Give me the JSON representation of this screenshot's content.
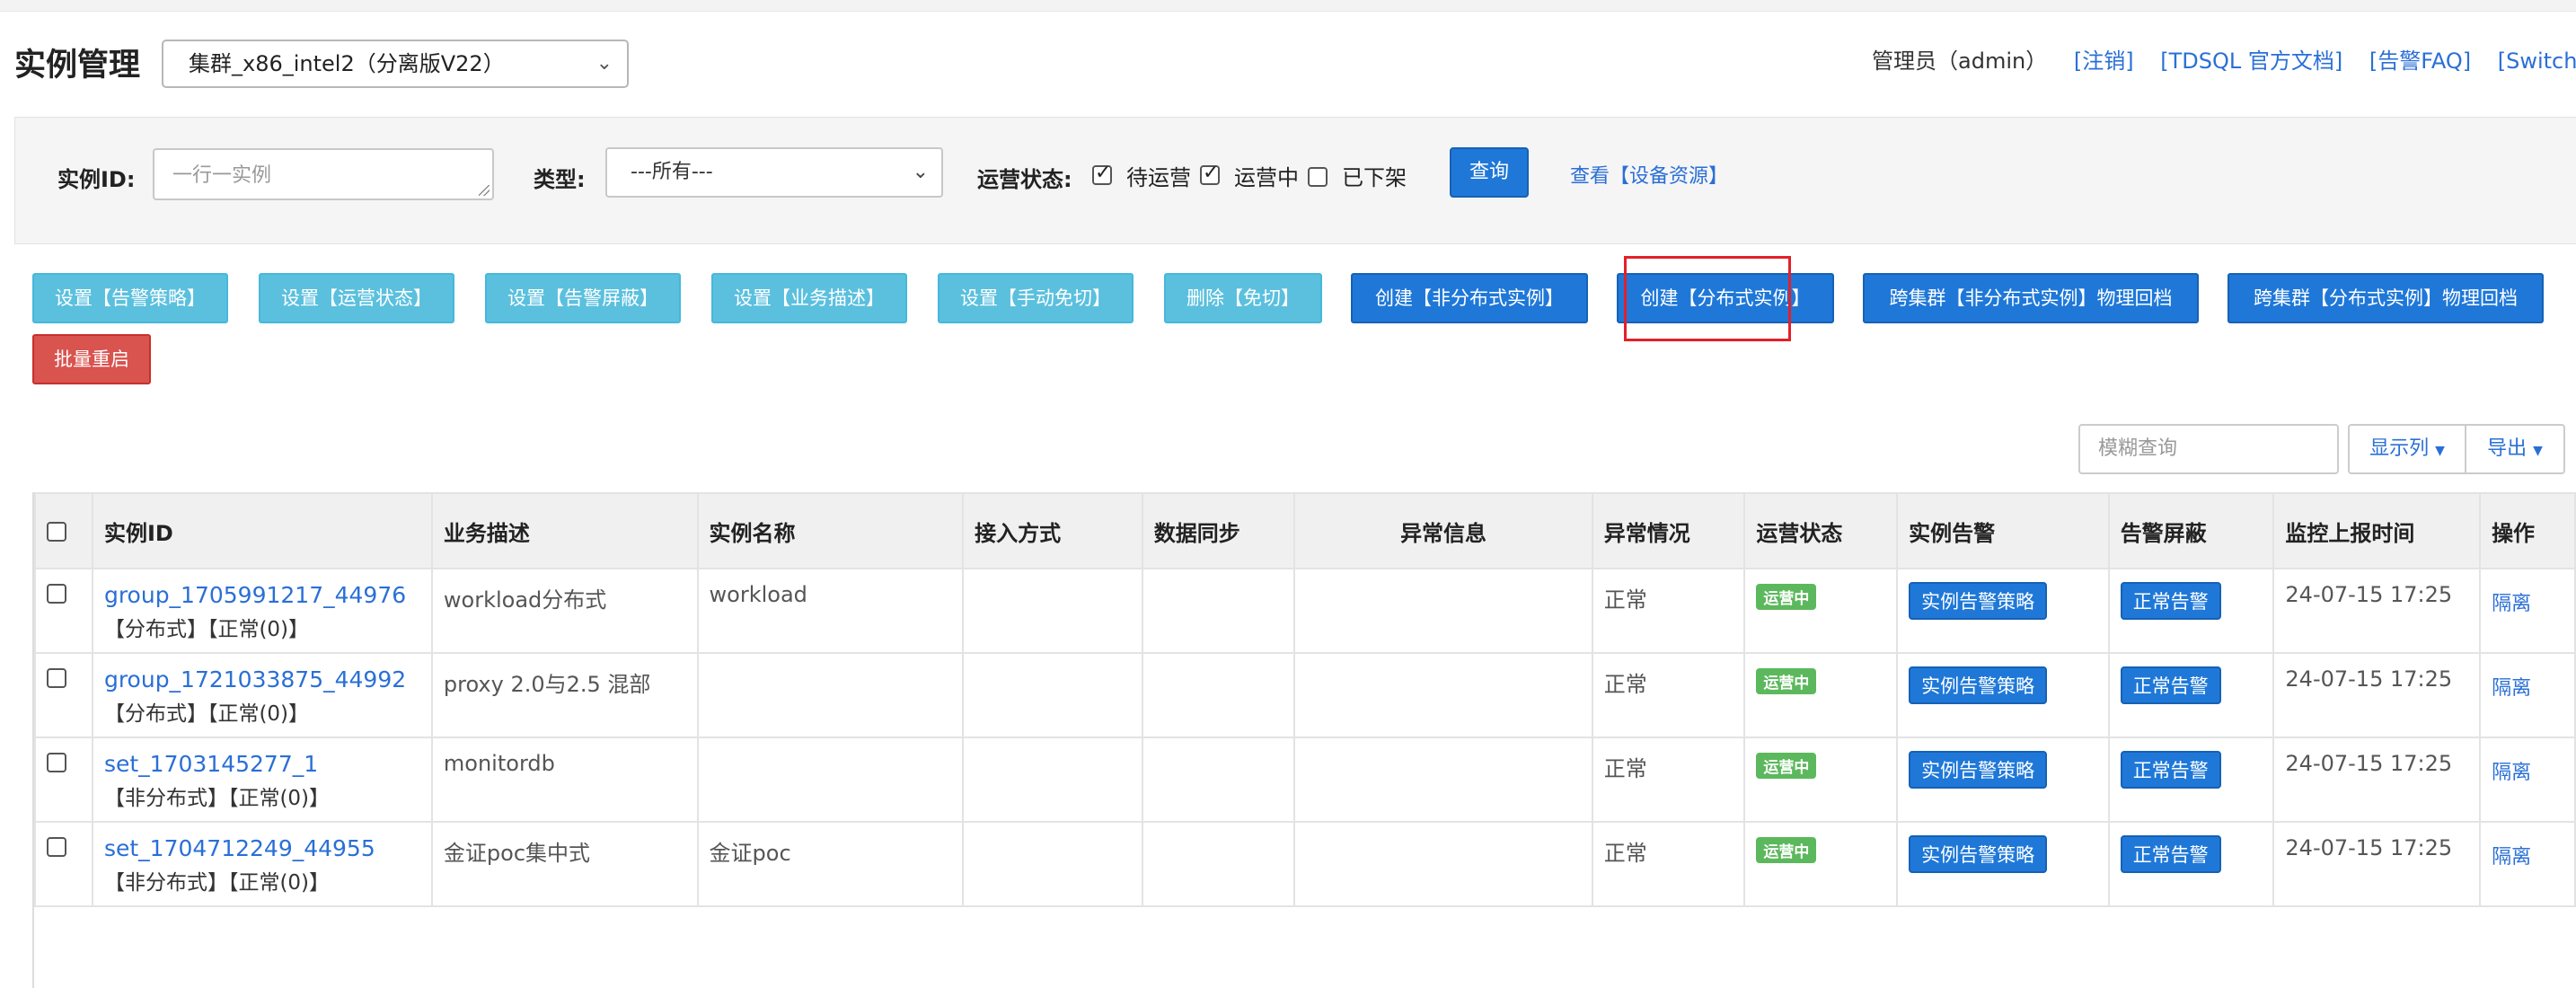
{
  "header": {
    "title": "实例管理",
    "cluster_select": "集群_x86_intel2（分离版V22）",
    "admin": "管理员（admin）",
    "links": [
      "[注销]",
      "[TDSQL 官方文档]",
      "[告警FAQ]",
      "[Switch English]"
    ]
  },
  "filter": {
    "id_label": "实例ID:",
    "id_placeholder": "一行一实例",
    "type_label": "类型:",
    "type_value": "---所有---",
    "status_label": "运营状态:",
    "status_options": [
      {
        "label": "待运营",
        "checked": true
      },
      {
        "label": "运营中",
        "checked": true
      },
      {
        "label": "已下架",
        "checked": false
      }
    ],
    "query_button": "查询",
    "view_link": "查看【设备资源】"
  },
  "actions": [
    "设置【告警策略】",
    "设置【运营状态】",
    "设置【告警屏蔽】",
    "设置【业务描述】",
    "设置【手动免切】",
    "删除【免切】",
    "创建【非分布式实例】",
    "创建【分布式实例】",
    "跨集群【非分布式实例】物理回档",
    "跨集群【分布式实例】物理回档",
    "批量重启"
  ],
  "toolbar": {
    "search_placeholder": "模糊查询",
    "columns_button": "显示列",
    "export_button": "导出"
  },
  "table": {
    "columns": [
      "实例ID",
      "业务描述",
      "实例名称",
      "接入方式",
      "数据同步",
      "异常信息",
      "异常情况",
      "运营状态",
      "实例告警",
      "告警屏蔽",
      "监控上报时间",
      "操作"
    ],
    "rows": [
      {
        "id": "group_1705991217_44976",
        "sub": "【分布式】【正常(0)】",
        "desc": "workload分布式",
        "name": "workload",
        "access": "",
        "sync": "",
        "error_info": "",
        "error_status": "正常",
        "status": "运营中",
        "alarm": "实例告警策略",
        "shield": "正常告警",
        "time": "24-07-15 17:25",
        "op": "隔离"
      },
      {
        "id": "group_1721033875_44992",
        "sub": "【分布式】【正常(0)】",
        "desc": "proxy 2.0与2.5 混部",
        "name": "",
        "access": "",
        "sync": "",
        "error_info": "",
        "error_status": "正常",
        "status": "运营中",
        "alarm": "实例告警策略",
        "shield": "正常告警",
        "time": "24-07-15 17:25",
        "op": "隔离"
      },
      {
        "id": "set_1703145277_1",
        "sub": "【非分布式】【正常(0)】",
        "desc": "monitordb",
        "name": "",
        "access": "",
        "sync": "",
        "error_info": "",
        "error_status": "正常",
        "status": "运营中",
        "alarm": "实例告警策略",
        "shield": "正常告警",
        "time": "24-07-15 17:25",
        "op": "隔离"
      },
      {
        "id": "set_1704712249_44955",
        "sub": "【非分布式】【正常(0)】",
        "desc": "金证poc集中式",
        "name": "金证poc",
        "access": "",
        "sync": "",
        "error_info": "",
        "error_status": "正常",
        "status": "运营中",
        "alarm": "实例告警策略",
        "shield": "正常告警",
        "time": "24-07-15 17:25",
        "op": "隔离"
      }
    ]
  },
  "colors": {
    "primary": "#1f78d8",
    "info": "#5bc0de",
    "danger": "#d9534f",
    "success": "#5cb85c",
    "link": "#2a6fd6",
    "highlight": "#e3202a"
  }
}
